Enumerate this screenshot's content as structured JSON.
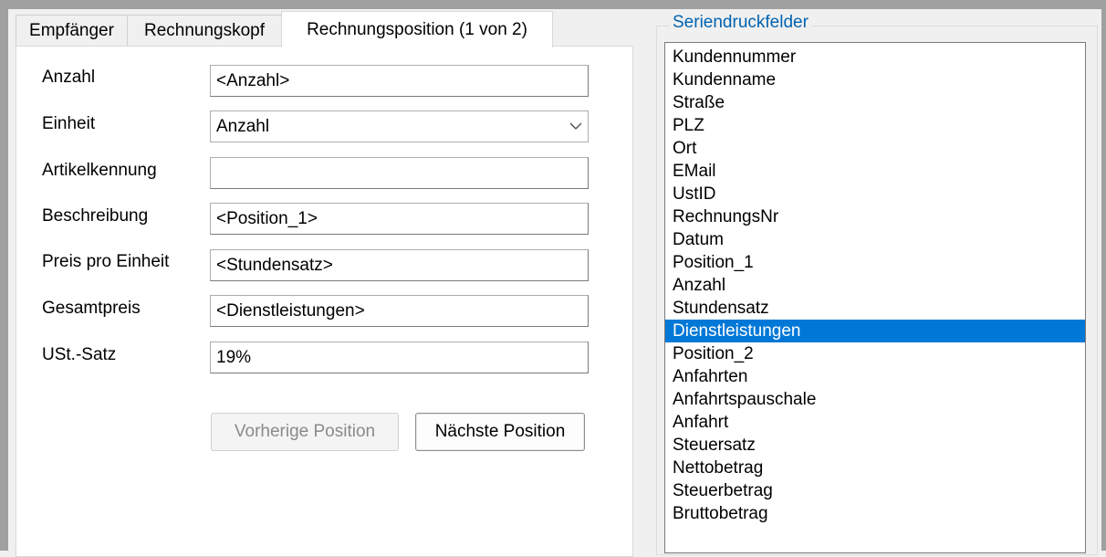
{
  "tabs": [
    {
      "label": "Empfänger"
    },
    {
      "label": "Rechnungskopf"
    },
    {
      "label": "Rechnungsposition (1 von 2)"
    }
  ],
  "form": {
    "anzahl": {
      "label": "Anzahl",
      "value": "<Anzahl>"
    },
    "einheit": {
      "label": "Einheit",
      "value": "Anzahl"
    },
    "artikelkennung": {
      "label": "Artikelkennung",
      "value": ""
    },
    "beschreibung": {
      "label": "Beschreibung",
      "value": "<Position_1>"
    },
    "preis": {
      "label": "Preis pro Einheit",
      "value": "<Stundensatz>"
    },
    "gesamtpreis": {
      "label": "Gesamtpreis",
      "value": "<Dienstleistungen>"
    },
    "ust": {
      "label": "USt.-Satz",
      "value": "19%"
    }
  },
  "buttons": {
    "prev": "Vorherige Position",
    "next": "Nächste Position"
  },
  "serienfelder": {
    "title": "Seriendruckfelder",
    "selected": "Dienstleistungen",
    "items": [
      "Kundennummer",
      "Kundenname",
      "Straße",
      "PLZ",
      "Ort",
      "EMail",
      "UstID",
      "RechnungsNr",
      "Datum",
      "Position_1",
      "Anzahl",
      "Stundensatz",
      "Dienstleistungen",
      "Position_2",
      "Anfahrten",
      "Anfahrtspauschale",
      "Anfahrt",
      "Steuersatz",
      "Nettobetrag",
      "Steuerbetrag",
      "Bruttobetrag"
    ]
  },
  "colors": {
    "selection": "#0078d7",
    "group_title": "#0063b1"
  }
}
